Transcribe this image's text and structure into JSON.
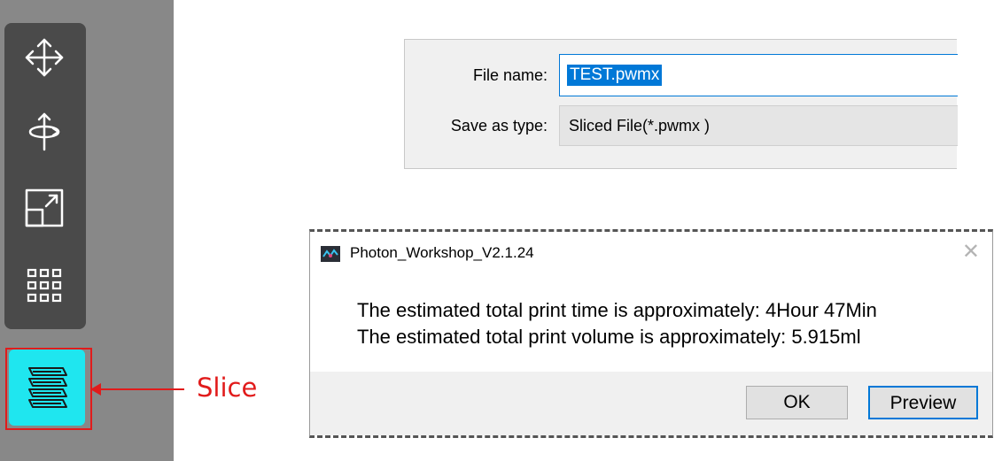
{
  "toolbar": {
    "items": [
      {
        "name": "move-icon"
      },
      {
        "name": "rotate-icon"
      },
      {
        "name": "scale-icon"
      },
      {
        "name": "layout-grid-icon"
      }
    ],
    "slice": {
      "name": "slice-layers-icon",
      "highlight_color": "#e11b1b",
      "button_color": "#1fe6ef"
    }
  },
  "annotation": {
    "label": "Slice",
    "color": "#e11b1b"
  },
  "save_dialog": {
    "file_name_label": "File name:",
    "file_name_value": "TEST.pwmx",
    "save_as_type_label": "Save as type:",
    "save_as_type_value": "Sliced File(*.pwmx )"
  },
  "message_dialog": {
    "title": "Photon_Workshop_V2.1.24",
    "line1": "The estimated total print time is approximately: 4Hour 47Min",
    "line2": "The estimated total print volume is approximately: 5.915ml",
    "ok_label": "OK",
    "preview_label": "Preview",
    "close_icon": "close-icon"
  }
}
